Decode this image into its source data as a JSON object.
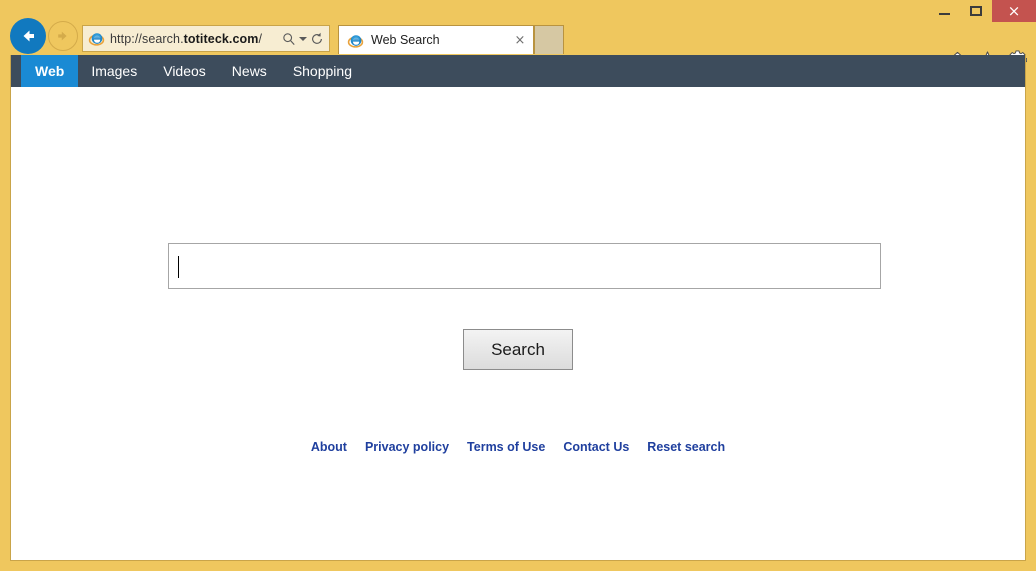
{
  "window": {
    "minimize_label": "Minimize",
    "maximize_label": "Maximize",
    "close_label": "×"
  },
  "toolbar": {
    "back_label": "Back",
    "forward_label": "Forward",
    "address": {
      "scheme_host": "http://search.",
      "domain": "totiteck.com",
      "path": "/",
      "full_url": "http://search.totiteck.com/",
      "placeholder": "http://search.totiteck.com/"
    },
    "search_icon_label": "search-icon",
    "caret_icon_label": "dropdown-caret",
    "refresh_icon_label": "refresh-icon"
  },
  "tabs": [
    {
      "title": "Web Search",
      "close_label": "×",
      "active": true
    }
  ],
  "new_tab_label": "",
  "chrome_icons": [
    {
      "name": "home-icon"
    },
    {
      "name": "favorites-star-icon"
    },
    {
      "name": "settings-gear-icon"
    }
  ],
  "site_nav": {
    "items": [
      {
        "label": "Web",
        "active": true
      },
      {
        "label": "Images",
        "active": false
      },
      {
        "label": "Videos",
        "active": false
      },
      {
        "label": "News",
        "active": false
      },
      {
        "label": "Shopping",
        "active": false
      }
    ]
  },
  "search": {
    "input_value": "",
    "input_placeholder": "",
    "button_label": "Search"
  },
  "footer": {
    "links": [
      {
        "label": "About"
      },
      {
        "label": "Privacy policy"
      },
      {
        "label": "Terms of Use"
      },
      {
        "label": "Contact Us"
      },
      {
        "label": "Reset search"
      }
    ]
  },
  "colors": {
    "chrome_background": "#efc75e",
    "nav_bar": "#3d4c5c",
    "nav_active": "#1a8ad4",
    "close_button": "#c4534f",
    "link": "#1f3f9e",
    "back_button": "#1179bf"
  }
}
